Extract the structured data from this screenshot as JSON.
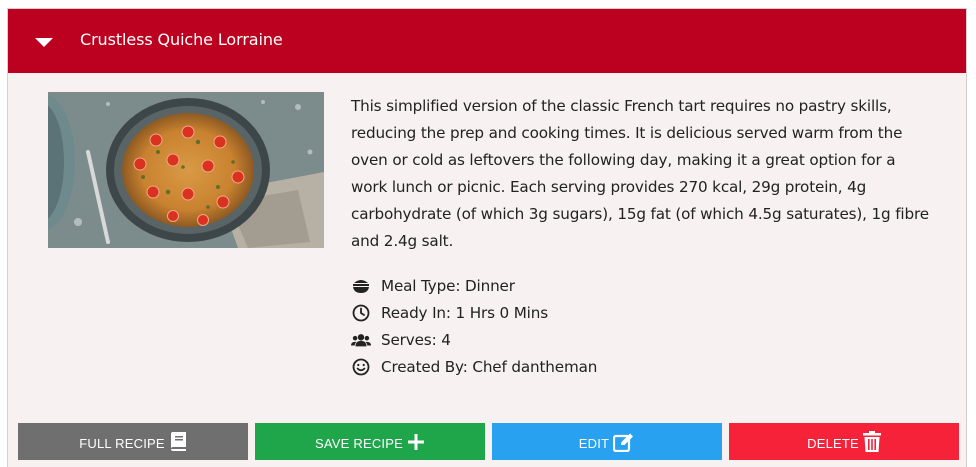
{
  "recipe": {
    "title": "Crustless Quiche Lorraine",
    "image_alt": "Crustless quiche with cherry tomatoes in a round dish",
    "description": "This simplified version of the classic French tart requires no pastry skills, reducing the prep and cooking times. It is delicious served warm from the oven or cold as leftovers the following day, making it a great option for a work lunch or picnic. Each serving provides 270 kcal, 29g protein, 4g carbohydrate (of which 3g sugars), 15g fat (of which 4.5g saturates), 1g fibre and 2.4g salt.",
    "meta": {
      "meal_type": "Meal Type: Dinner",
      "ready_in": "Ready In: 1 Hrs 0 Mins",
      "serves": "Serves: 4",
      "created_by": "Created By: Chef dantheman"
    }
  },
  "actions": {
    "full_recipe": "FULL RECIPE",
    "save_recipe": "SAVE RECIPE",
    "edit": "EDIT",
    "delete": "DELETE"
  },
  "colors": {
    "header": "#bb0020",
    "card_bg": "#f7f1f1",
    "full_recipe_btn": "#6f6f6f",
    "save_btn": "#1fa64b",
    "edit_btn": "#27a1f0",
    "delete_btn": "#f5223a"
  },
  "icons": {
    "header": "caret-down-icon",
    "meal_type": "bowl-icon",
    "ready_in": "clock-icon",
    "serves": "users-icon",
    "created_by": "smile-icon",
    "full_recipe": "book-icon",
    "save_recipe": "plus-icon",
    "edit": "edit-icon",
    "delete": "trash-icon"
  }
}
